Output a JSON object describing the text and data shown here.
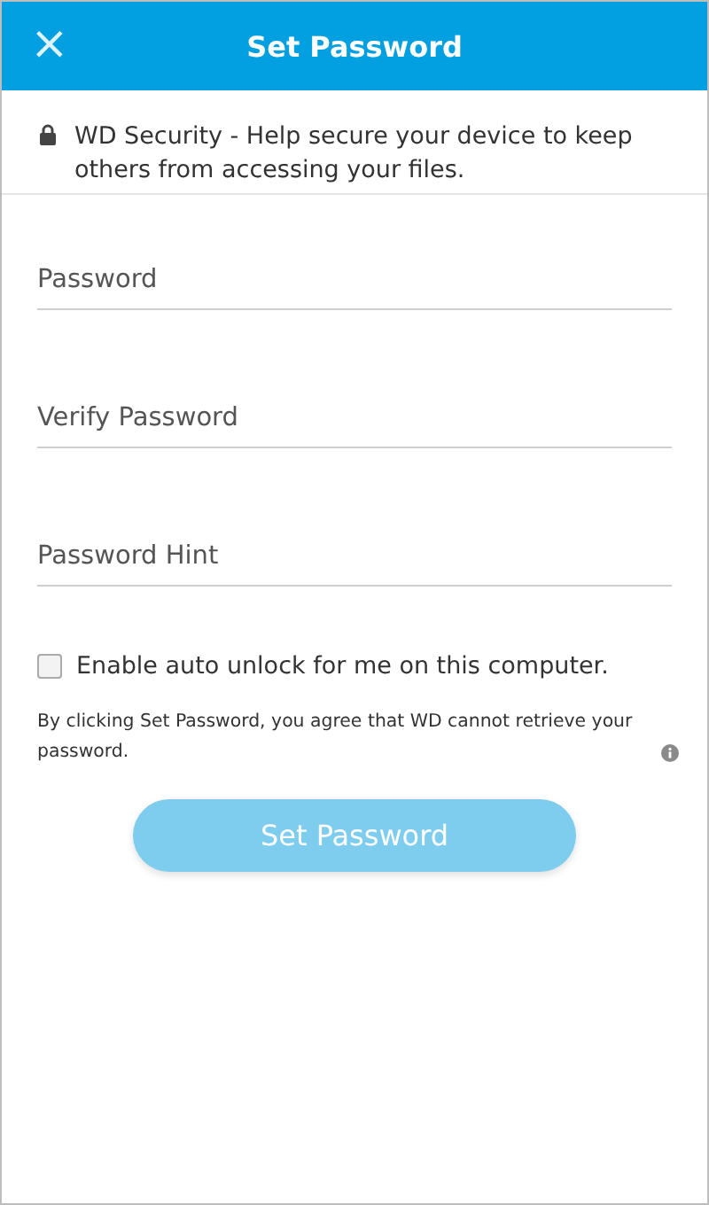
{
  "header": {
    "close": "×",
    "title": "Set Password"
  },
  "info": {
    "text": "WD Security - Help secure your device to keep others from accessing your files."
  },
  "fields": [
    {
      "placeholder": "Password"
    },
    {
      "placeholder": "Verify Password"
    },
    {
      "placeholder": "Password Hint"
    }
  ],
  "auto_unlock": {
    "label": "Enable auto unlock for me on this computer.",
    "checked": false
  },
  "note": "By clicking Set Password, you agree that WD cannot retrieve your password.",
  "submit": {
    "label": "Set Password",
    "disabled": true
  }
}
